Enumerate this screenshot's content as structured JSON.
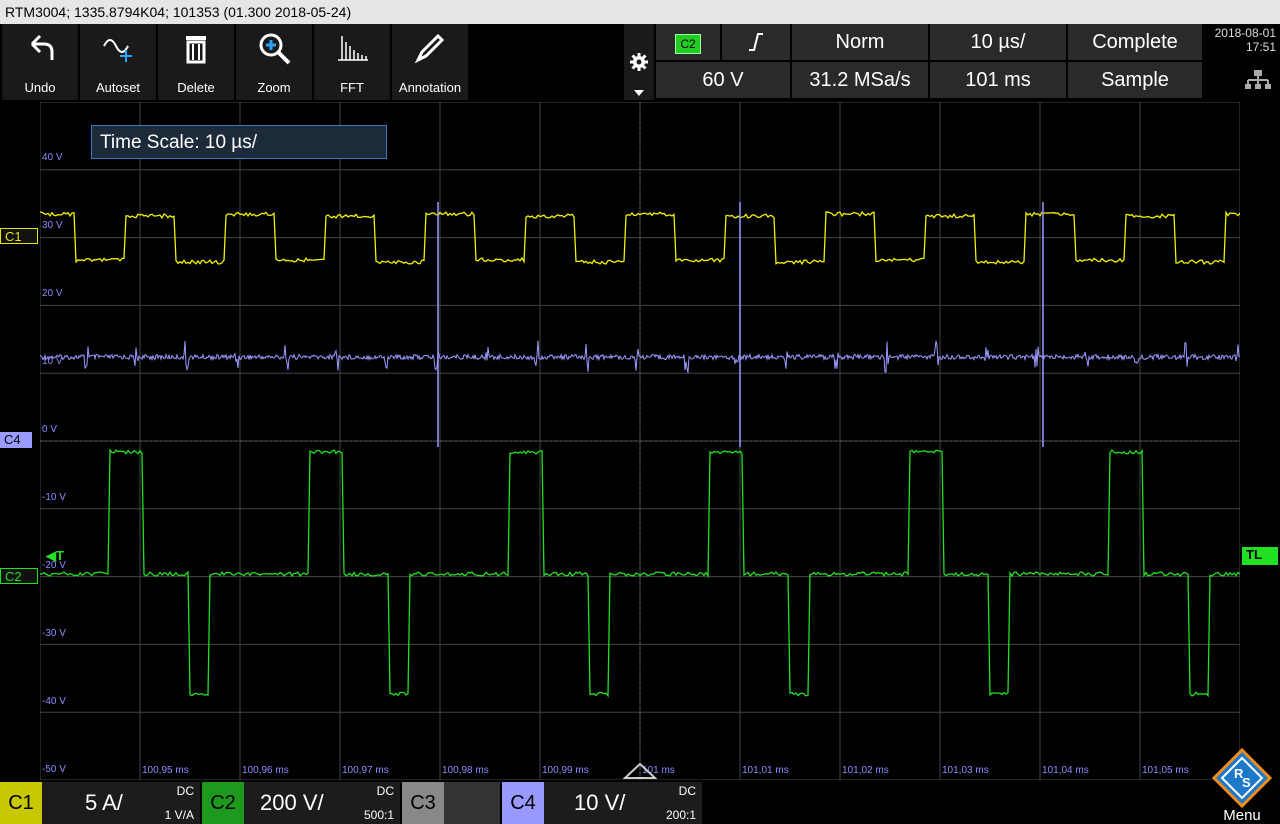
{
  "titlebar": {
    "text": "RTM3004; 1335.8794K04; 101353 (01.300 2018-05-24)"
  },
  "toolbar": {
    "buttons": [
      {
        "label": "Undo",
        "icon": "undo-icon"
      },
      {
        "label": "Autoset",
        "icon": "autoset-icon"
      },
      {
        "label": "Delete",
        "icon": "delete-icon"
      },
      {
        "label": "Zoom",
        "icon": "zoom-icon"
      },
      {
        "label": "FFT",
        "icon": "fft-icon"
      },
      {
        "label": "Annotation",
        "icon": "annotation-icon"
      }
    ]
  },
  "trigger": {
    "source": "C2",
    "mode": "Norm",
    "timebase": "10 µs/",
    "acq_state": "Complete",
    "level": "60 V",
    "sample_rate": "31.2 MSa/s",
    "record": "101 ms",
    "acq_mode": "Sample"
  },
  "datetime": {
    "date": "2018-08-01",
    "time": "17:51"
  },
  "tooltip": {
    "text": "Time Scale: 10 µs/"
  },
  "voltage_labels": [
    "40 V",
    "30 V",
    "20 V",
    "10 V",
    "0 V",
    "-10 V",
    "-20 V",
    "-30 V",
    "-40 V",
    "-50 V"
  ],
  "time_labels": [
    "100,95 ms",
    "100,96 ms",
    "100,97 ms",
    "100,98 ms",
    "100,99 ms",
    "101 ms",
    "101,01 ms",
    "101,02 ms",
    "101,03 ms",
    "101,04 ms",
    "101,05 ms"
  ],
  "markers": {
    "c1": "C1",
    "c4": "C4",
    "c2": "C2",
    "tl": "TL",
    "t": "T"
  },
  "channels": [
    {
      "tag": "C1",
      "value": "5 A/",
      "coupling": "DC",
      "probe": "1 V/A",
      "color": "#e6e600"
    },
    {
      "tag": "C2",
      "value": "200 V/",
      "coupling": "DC",
      "probe": "500:1",
      "color": "#00cc33"
    },
    {
      "tag": "C3",
      "value": "",
      "coupling": "",
      "probe": "",
      "color": "#888888"
    },
    {
      "tag": "C4",
      "value": "10 V/",
      "coupling": "DC",
      "probe": "200:1",
      "color": "#9999ff"
    }
  ],
  "menu": {
    "label": "Menu"
  },
  "colors": {
    "c1": "#f2f200",
    "c2": "#22e022",
    "c4": "#9a9aff",
    "grid": "#444444"
  }
}
